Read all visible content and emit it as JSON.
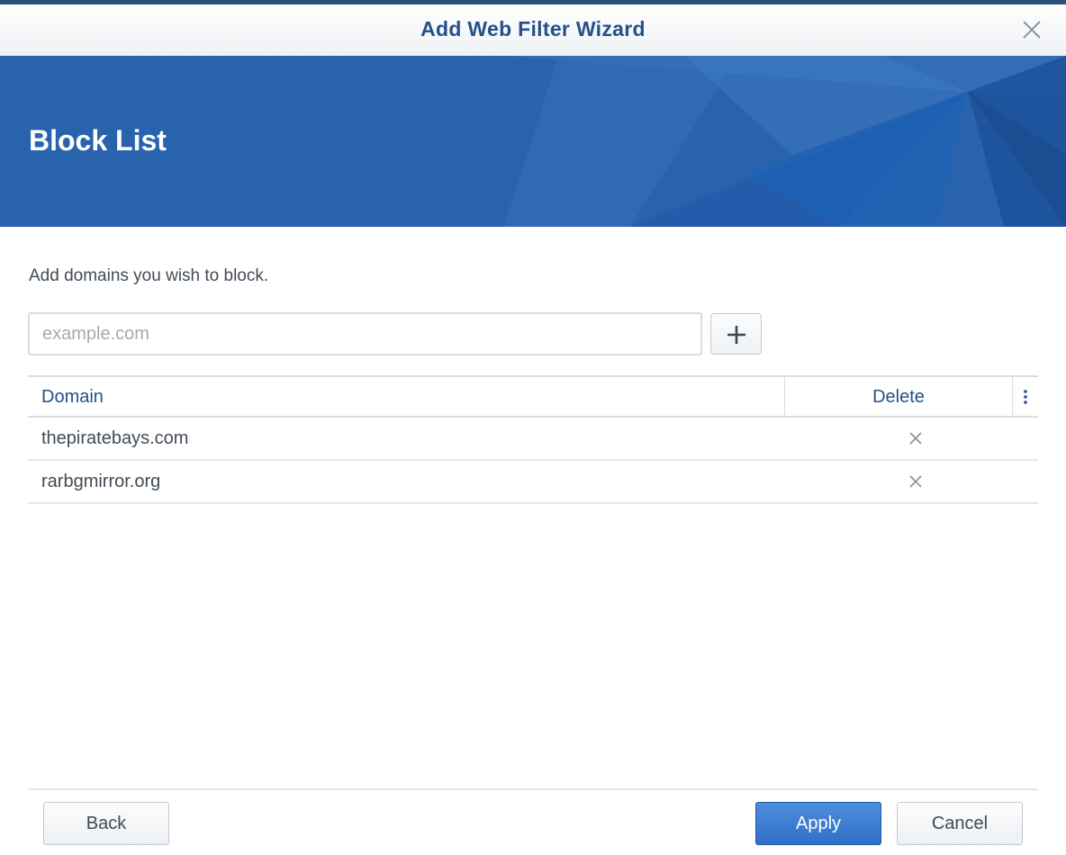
{
  "window": {
    "title": "Add Web Filter Wizard",
    "close_icon": "close-icon"
  },
  "banner": {
    "title": "Block List",
    "accent_color": "#2a63ad"
  },
  "content": {
    "description": "Add domains you wish to block.",
    "input": {
      "placeholder": "example.com",
      "value": ""
    },
    "add_icon": "plus-icon"
  },
  "table": {
    "headers": {
      "domain": "Domain",
      "delete": "Delete"
    },
    "menu_icon": "column-menu-icon",
    "rows": [
      {
        "domain": "thepiratebays.com",
        "delete_icon": "delete-x-icon"
      },
      {
        "domain": "rarbgmirror.org",
        "delete_icon": "delete-x-icon"
      }
    ]
  },
  "footer": {
    "back_label": "Back",
    "apply_label": "Apply",
    "cancel_label": "Cancel",
    "primary_color": "#2f6fc6"
  }
}
